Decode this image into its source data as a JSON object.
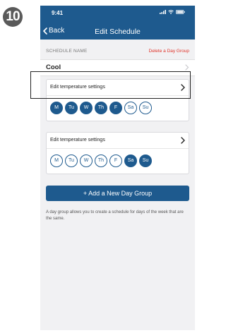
{
  "step_number": "10",
  "status_bar": {
    "time": "9:41",
    "icons": [
      "signal-icon",
      "wifi-icon",
      "battery-icon"
    ]
  },
  "nav": {
    "back_label": "Back",
    "title": "Edit Schedule"
  },
  "schedule_name": {
    "section_label": "SCHEDULE NAME",
    "delete_label": "Delete a Day Group",
    "value": "Cool"
  },
  "day_groups": [
    {
      "header_label": "Edit temperature settings",
      "days": [
        {
          "label": "M",
          "selected": true
        },
        {
          "label": "Tu",
          "selected": true
        },
        {
          "label": "W",
          "selected": true
        },
        {
          "label": "Th",
          "selected": true
        },
        {
          "label": "F",
          "selected": true
        },
        {
          "label": "Sa",
          "selected": false
        },
        {
          "label": "Su",
          "selected": false
        }
      ]
    },
    {
      "header_label": "Edit temperature settings",
      "days": [
        {
          "label": "M",
          "selected": false
        },
        {
          "label": "Tu",
          "selected": false
        },
        {
          "label": "W",
          "selected": false
        },
        {
          "label": "Th",
          "selected": false
        },
        {
          "label": "F",
          "selected": false
        },
        {
          "label": "Sa",
          "selected": true
        },
        {
          "label": "Su",
          "selected": true
        }
      ]
    }
  ],
  "add_button_label": "+ Add a New Day Group",
  "helper_text": "A day group allows you to create a schedule for days of the week that are the same.",
  "colors": {
    "accent": "#1e5a8e",
    "delete": "#e0342a",
    "background": "#f1f1f3"
  }
}
